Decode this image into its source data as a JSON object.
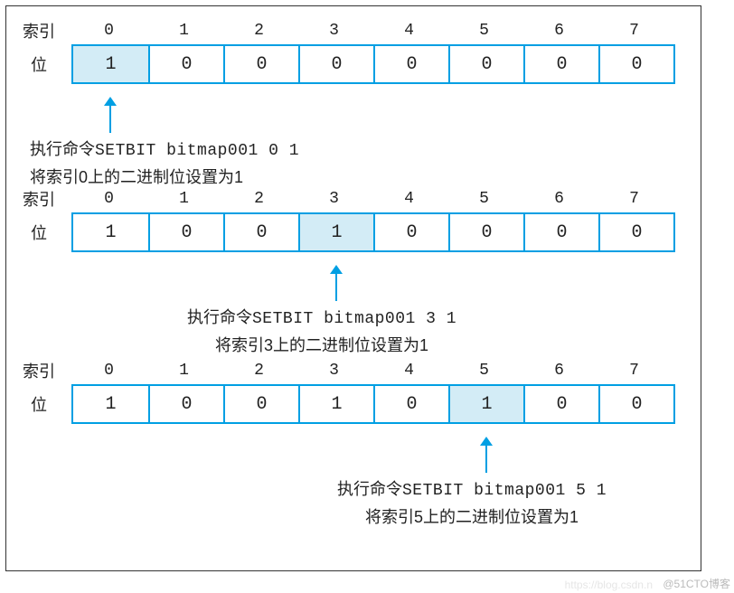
{
  "labels": {
    "index": "索引",
    "bit": "位"
  },
  "indices": [
    "0",
    "1",
    "2",
    "3",
    "4",
    "5",
    "6",
    "7"
  ],
  "diagrams": [
    {
      "bits": [
        "1",
        "0",
        "0",
        "0",
        "0",
        "0",
        "0",
        "0"
      ],
      "highlight": 0,
      "cmd_prefix": "执行命令",
      "cmd": "SETBIT bitmap001 0 1",
      "desc": "将索引0上的二进制位设置为1"
    },
    {
      "bits": [
        "1",
        "0",
        "0",
        "1",
        "0",
        "0",
        "0",
        "0"
      ],
      "highlight": 3,
      "cmd_prefix": "执行命令",
      "cmd": "SETBIT bitmap001 3 1",
      "desc": "将索引3上的二进制位设置为1"
    },
    {
      "bits": [
        "1",
        "0",
        "0",
        "1",
        "0",
        "1",
        "0",
        "0"
      ],
      "highlight": 5,
      "cmd_prefix": "执行命令",
      "cmd": "SETBIT bitmap001 5 1",
      "desc": "将索引5上的二进制位设置为1"
    }
  ],
  "watermark": "@51CTO博客",
  "watermark2": "https://blog.csdn.n"
}
